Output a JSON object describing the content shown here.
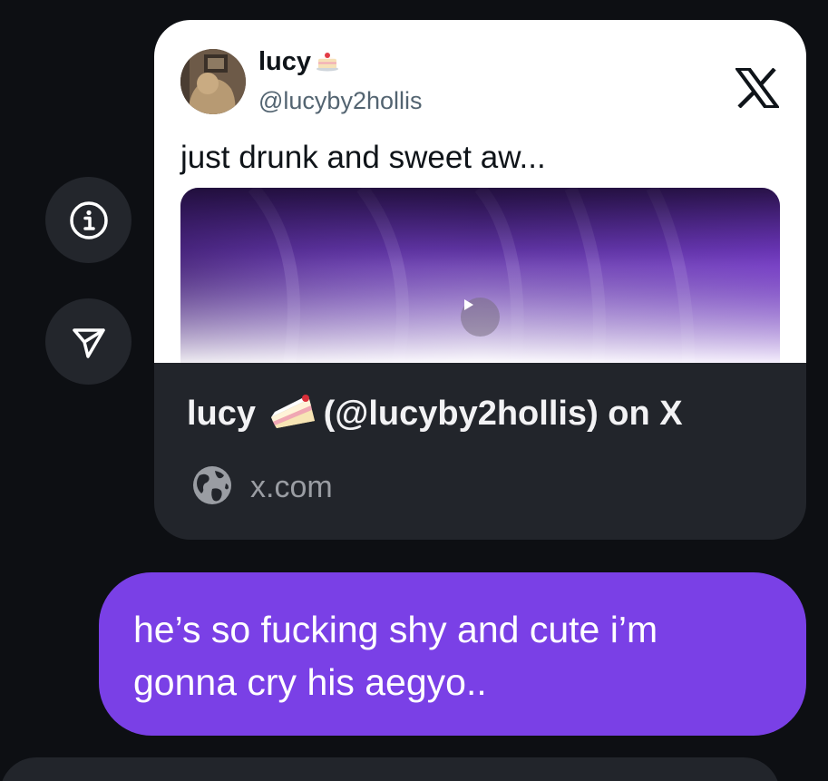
{
  "side_buttons": {
    "info_icon": "info-circle-icon",
    "share_icon": "send-icon"
  },
  "embed": {
    "author_name": "lucy",
    "author_handle": "@lucyby2hollis",
    "tweet_text": "just drunk and sweet aw...",
    "brand_icon": "x-logo-icon",
    "media_type": "video",
    "link_title_name": "lucy",
    "link_title_rest": "(@lucyby2hollis) on X",
    "link_domain": "x.com",
    "colors": {
      "card_bg": "#22252b",
      "tweet_bg": "#ffffff",
      "media_accent": "#6b3db0"
    }
  },
  "message": {
    "text": "he’s so fucking shy and cute i’m gonna cry his aegyo..",
    "bubble_color": "#7a40e6"
  }
}
